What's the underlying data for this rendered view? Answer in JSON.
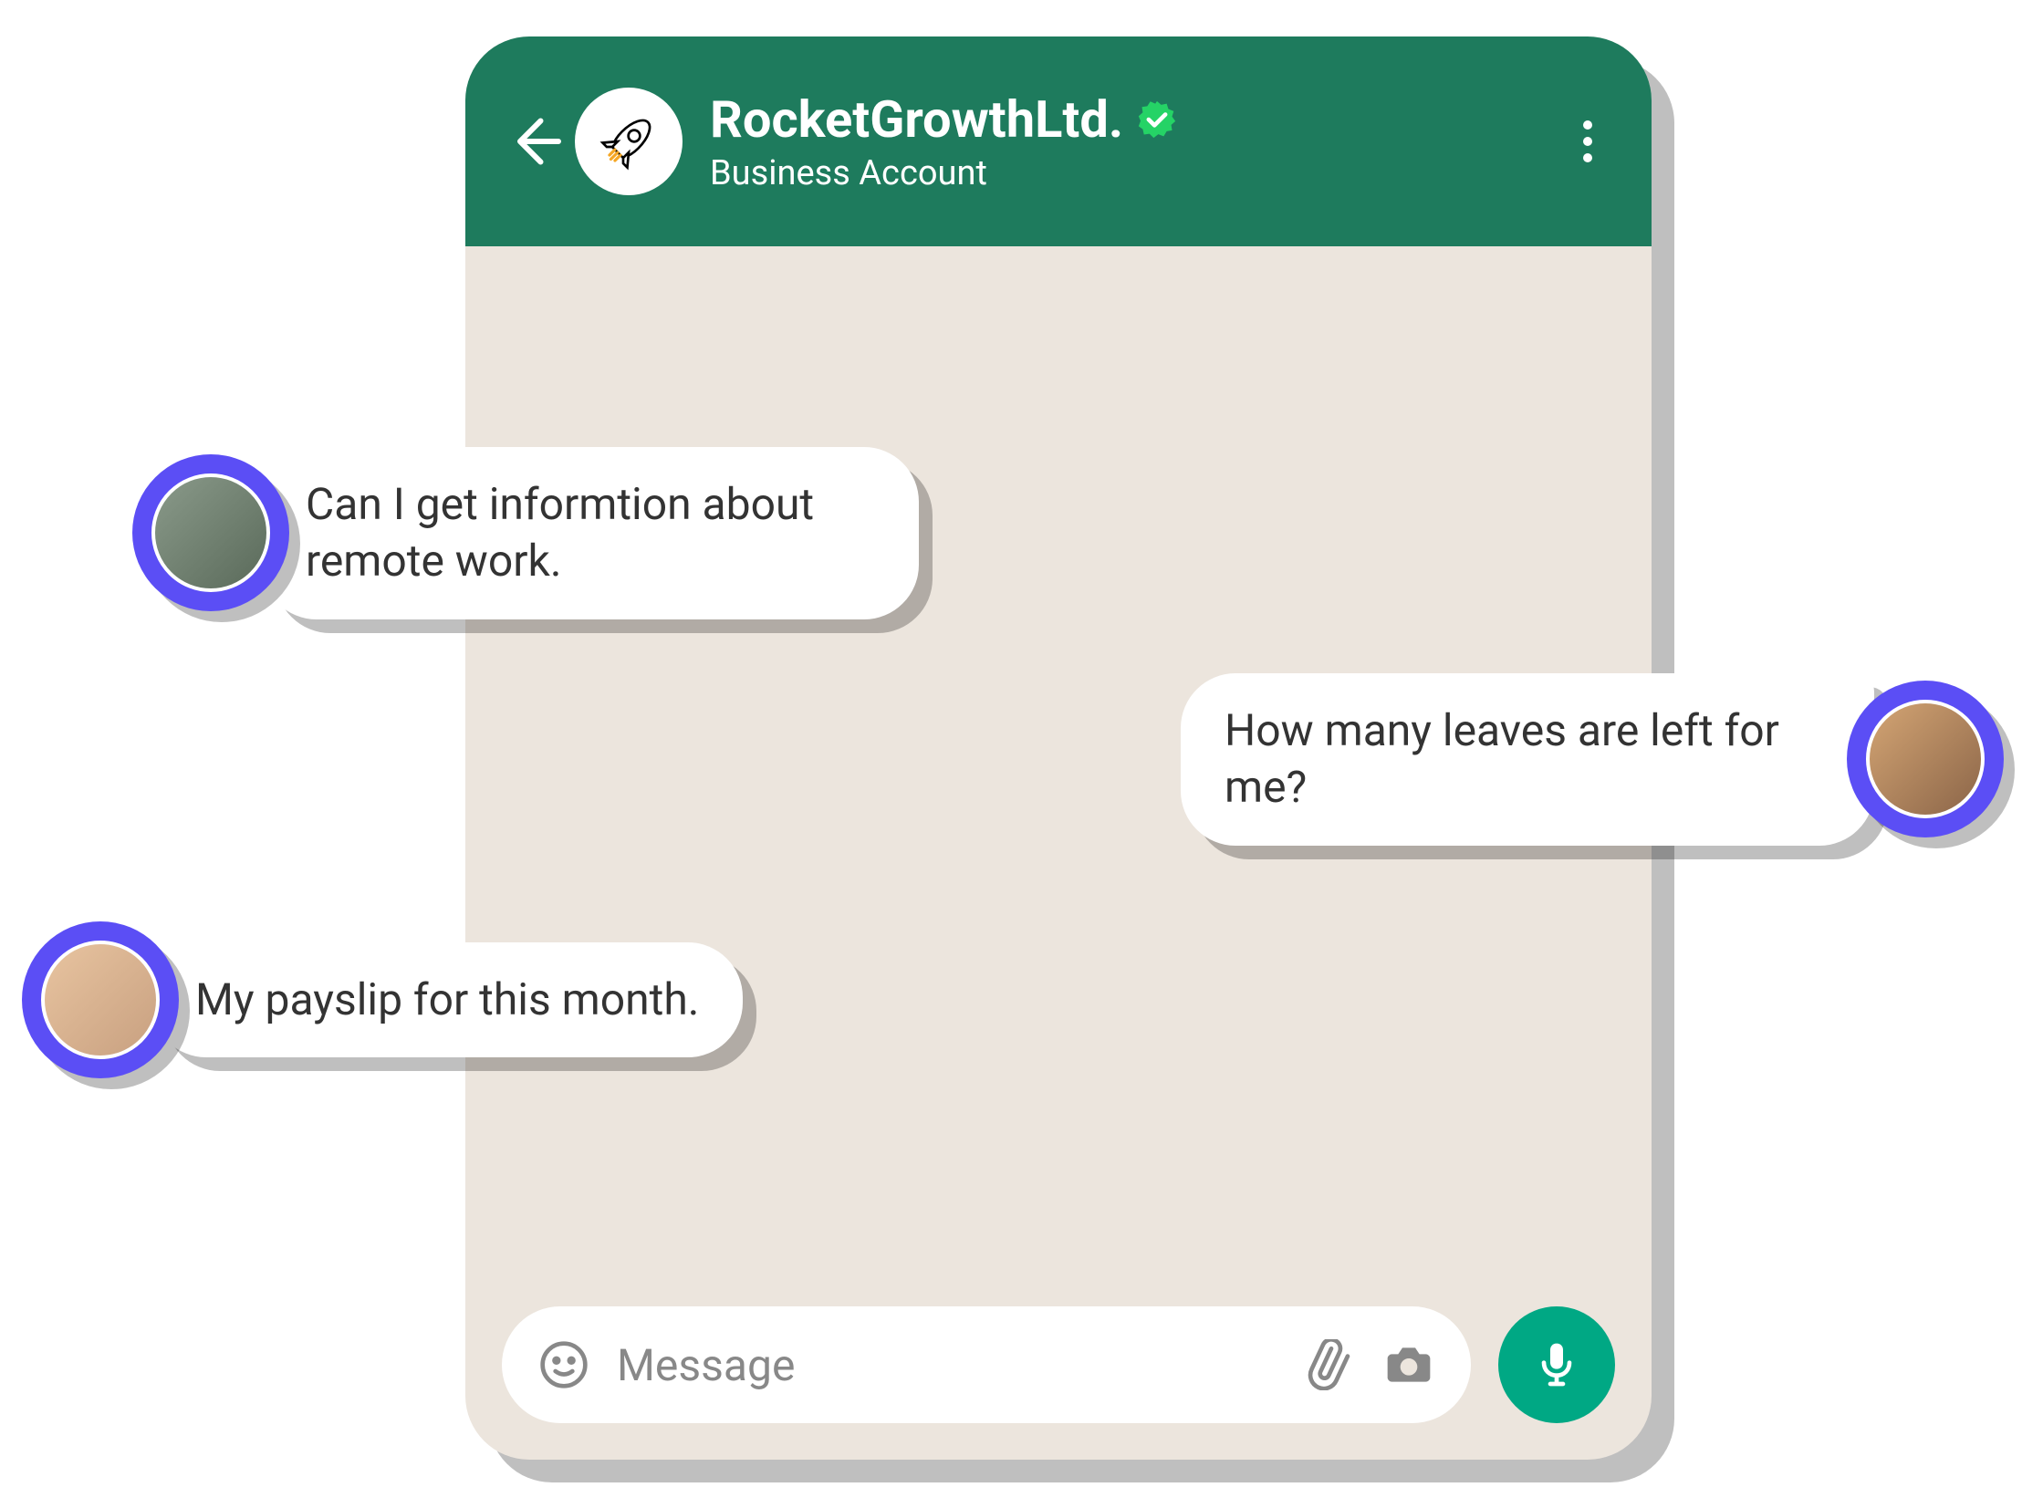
{
  "header": {
    "title": "RocketGrowthLtd.",
    "subtitle": "Business Account",
    "avatar_icon": "rocket-icon",
    "verified": true
  },
  "messages": [
    {
      "side": "left",
      "text": "Can I get informtion about remote work."
    },
    {
      "side": "right",
      "text": "How many leaves are left for me?"
    },
    {
      "side": "left",
      "text": "My payslip for this month."
    }
  ],
  "input": {
    "placeholder": "Message"
  },
  "colors": {
    "header_bg": "#1e7b5d",
    "chat_bg": "#ece5dd",
    "accent": "#00a884",
    "avatar_ring": "#5b4ef5",
    "verified_badge": "#25d366"
  }
}
